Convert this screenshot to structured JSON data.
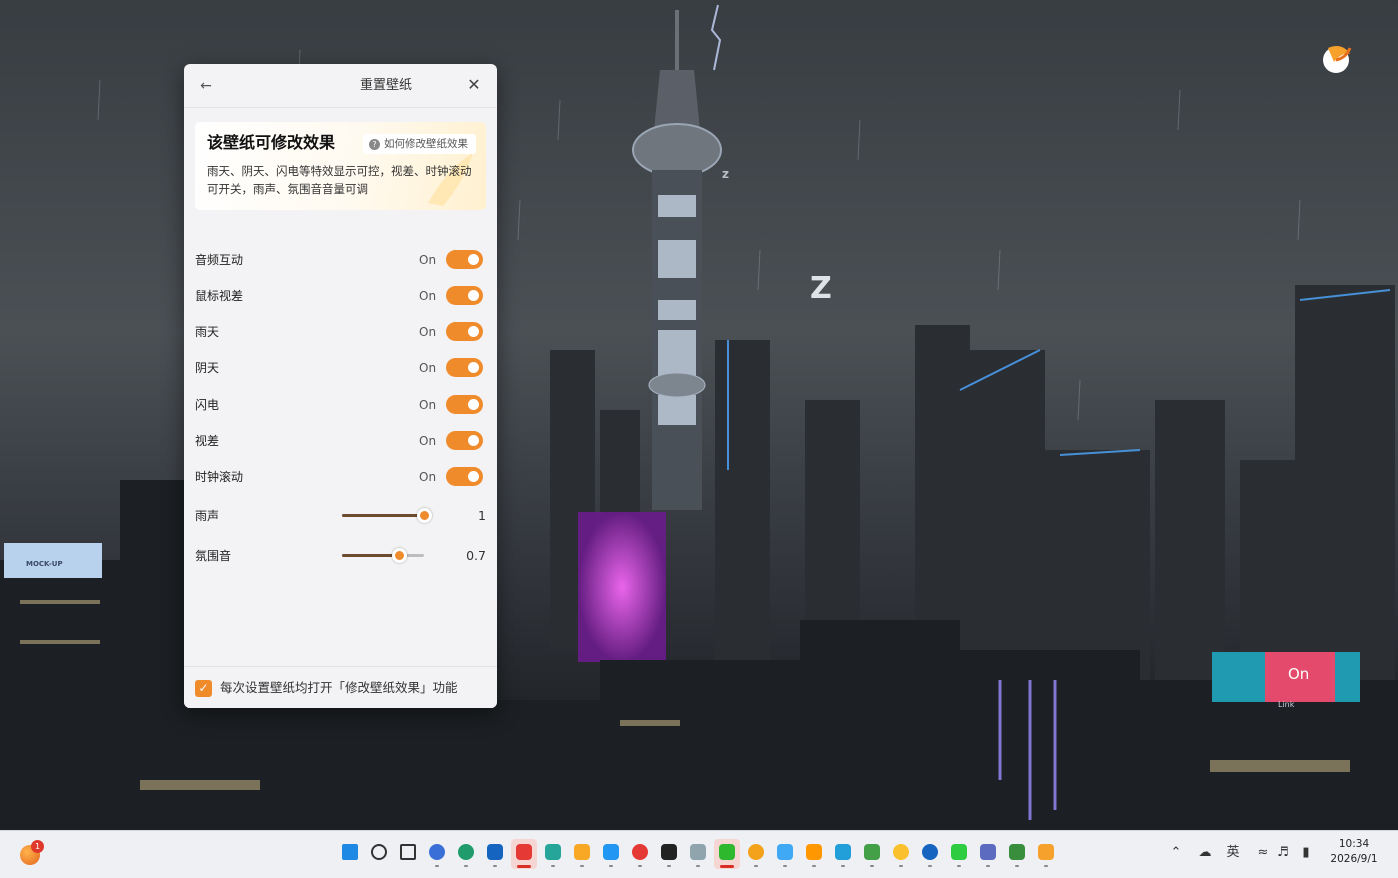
{
  "panel": {
    "title": "重置壁纸",
    "back_icon": "arrow-left-icon",
    "close_icon": "close-icon",
    "info_title": "该壁纸可修改效果",
    "help_label": "如何修改壁纸效果",
    "info_desc": "雨天、阴天、闪电等特效显示可控，视差、时钟滚动可开关，雨声、氛围音音量可调",
    "toggles": [
      {
        "label": "音频互动",
        "state": "On"
      },
      {
        "label": "鼠标视差",
        "state": "On"
      },
      {
        "label": "雨天",
        "state": "On"
      },
      {
        "label": "阴天",
        "state": "On"
      },
      {
        "label": "闪电",
        "state": "On"
      },
      {
        "label": "视差",
        "state": "On"
      },
      {
        "label": "时钟滚动",
        "state": "On"
      }
    ],
    "sliders": [
      {
        "label": "雨声",
        "value": "1",
        "level": 1.0
      },
      {
        "label": "氛围音",
        "value": "0.7",
        "level": 0.7
      }
    ],
    "footer_label": "每次设置壁纸均打开「修改壁纸效果」功能",
    "footer_checked": true,
    "accent": "#f08b2c"
  },
  "wallpaper": {
    "billboard_left": "MOCK-UP",
    "billboard_right": "On",
    "billboard_right_sub": "Link"
  },
  "taskbar": {
    "notification_badge": "1",
    "time": "10:34",
    "date": "2026/9/1",
    "ime_label": "英",
    "tray_icons": [
      "chevron-up-icon",
      "network-status-icon",
      "wifi-icon",
      "speaker-icon",
      "battery-icon"
    ],
    "apps": [
      "windows-start-icon",
      "search-icon",
      "task-view-icon",
      "browser-icon",
      "edge-icon",
      "store-icon",
      "pinterest-icon",
      "photo-app-icon",
      "file-explorer-icon",
      "sync-app-icon",
      "chrome-icon",
      "qq-icon",
      "notes-icon",
      "wechat-icon",
      "browser-2-icon",
      "calculator-icon",
      "game-icon",
      "telegram-icon",
      "chat-app-icon",
      "lemon-icon",
      "video-app-icon",
      "message-app-icon",
      "cloud-icon",
      "vpn-icon",
      "wallpaper-app-icon"
    ]
  }
}
